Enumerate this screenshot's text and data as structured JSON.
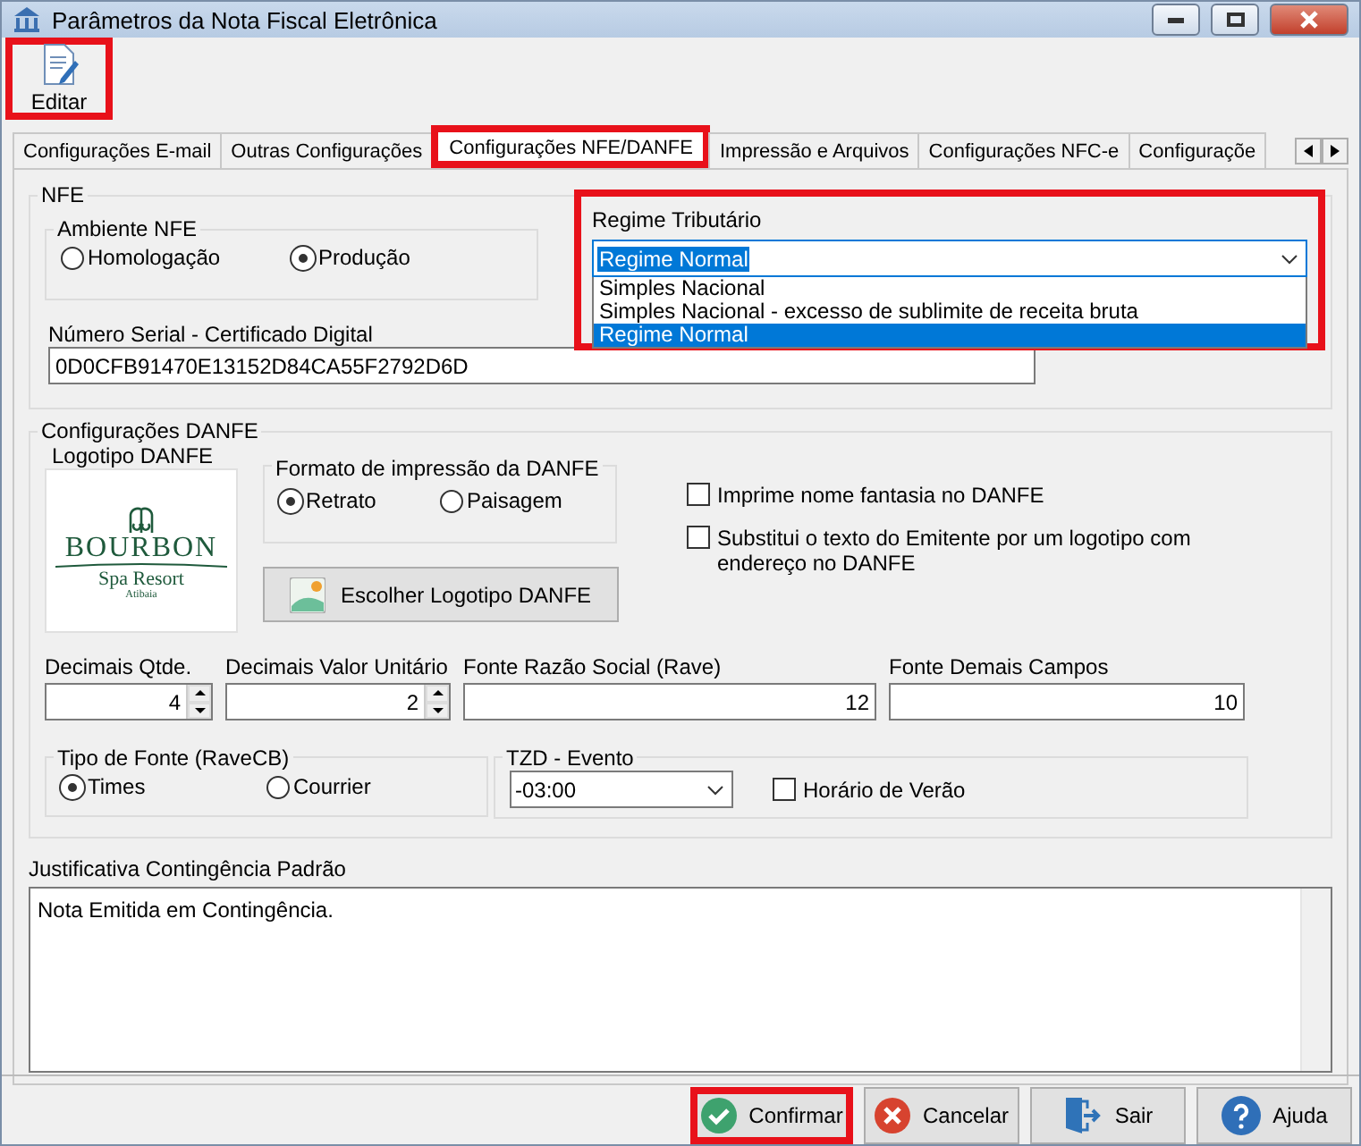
{
  "window": {
    "title": "Parâmetros da Nota Fiscal Eletrônica"
  },
  "toolbar": [
    {
      "label": "Editar",
      "highlighted": true
    }
  ],
  "tabs": [
    {
      "label": "Configurações E-mail",
      "selected": false,
      "highlighted": false
    },
    {
      "label": "Outras Configurações",
      "selected": false,
      "highlighted": false
    },
    {
      "label": "Configurações NFE/DANFE",
      "selected": true,
      "highlighted": true
    },
    {
      "label": "Impressão e Arquivos",
      "selected": false,
      "highlighted": false
    },
    {
      "label": "Configurações NFC-e",
      "selected": false,
      "highlighted": false
    },
    {
      "label": "Configuraçõe",
      "selected": false,
      "highlighted": false
    }
  ],
  "nfe": {
    "title": "NFE",
    "ambiente": {
      "title": "Ambiente NFE",
      "options": [
        {
          "label": "Homologação",
          "selected": false
        },
        {
          "label": "Produção",
          "selected": true
        }
      ]
    },
    "regime": {
      "label": "Regime Tributário",
      "value": "Regime Normal",
      "expanded": true,
      "highlighted": true,
      "options": [
        {
          "label": "Simples Nacional",
          "selected": false
        },
        {
          "label": "Simples Nacional - excesso de sublimite de receita bruta",
          "selected": false
        },
        {
          "label": "Regime Normal",
          "selected": true
        }
      ]
    },
    "serial": {
      "label": "Número Serial - Certificado Digital",
      "value": "0D0CFB91470E13152D84CA55F2792D6D"
    }
  },
  "danfe": {
    "title": "Configurações DANFE",
    "logo": {
      "label": "Logotipo DANFE",
      "lines": [
        "BOURBON",
        "Spa Resort",
        "Atibaia"
      ]
    },
    "formato": {
      "title": "Formato de impressão da DANFE",
      "options": [
        {
          "label": "Retrato",
          "selected": true
        },
        {
          "label": "Paisagem",
          "selected": false
        }
      ]
    },
    "choose_logo_button": "Escolher Logotipo DANFE",
    "checkboxes": [
      {
        "label": "Imprime nome fantasia no DANFE",
        "checked": false
      },
      {
        "label": "Substitui o texto do Emitente por um logotipo com endereço no DANFE",
        "checked": false
      }
    ],
    "fields": [
      {
        "label": "Decimais Qtde.",
        "value": "4",
        "kind": "spin"
      },
      {
        "label": "Decimais Valor Unitário",
        "value": "2",
        "kind": "spin"
      },
      {
        "label": "Fonte Razão Social (Rave)",
        "value": "12",
        "kind": "text"
      },
      {
        "label": "Fonte Demais Campos",
        "value": "10",
        "kind": "text"
      }
    ],
    "tipo_fonte": {
      "title": "Tipo de Fonte (RaveCB)",
      "options": [
        {
          "label": "Times",
          "selected": true
        },
        {
          "label": "Courrier",
          "selected": false
        }
      ]
    },
    "tzd": {
      "title": "TZD - Evento",
      "value": "-03:00",
      "checkbox": {
        "label": "Horário de Verão",
        "checked": false
      }
    },
    "justificativa": {
      "label": "Justificativa Contingência Padrão",
      "value": "Nota Emitida em Contingência."
    }
  },
  "buttons": [
    {
      "label": "Confirmar",
      "kind": "confirm",
      "highlighted": true
    },
    {
      "label": "Cancelar",
      "kind": "cancel",
      "highlighted": false
    },
    {
      "label": "Sair",
      "kind": "exit",
      "highlighted": false
    },
    {
      "label": "Ajuda",
      "kind": "help",
      "highlighted": false
    }
  ]
}
